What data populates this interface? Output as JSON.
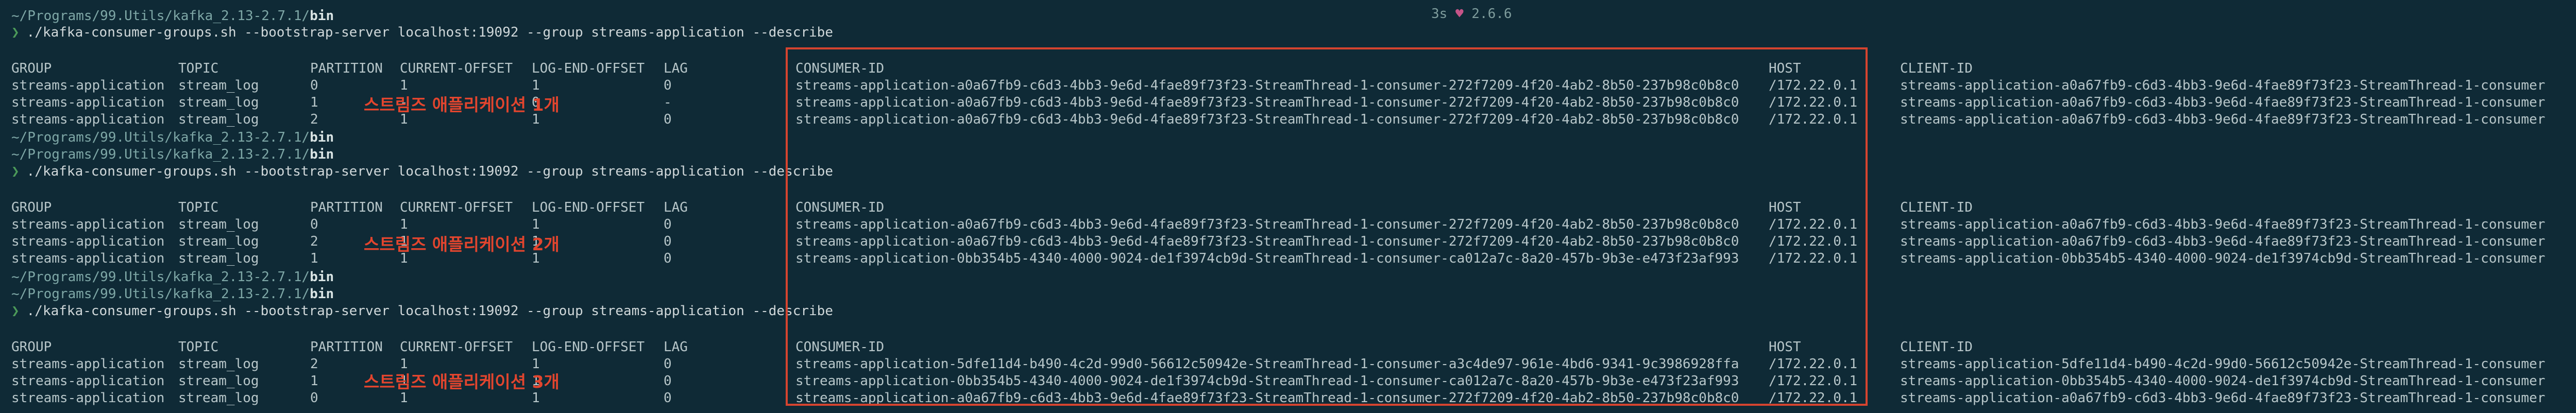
{
  "status": {
    "duration": "3s",
    "heart": "♥",
    "version": "2.6.6"
  },
  "path_prefix": "~/Programs/99.Utils/kafka_2.13-2.7.1/",
  "path_bin": "bin",
  "prompt_symbol": "❯",
  "command": "./kafka-consumer-groups.sh --bootstrap-server localhost:19092 --group streams-application --describe",
  "headers": {
    "group": "GROUP",
    "topic": "TOPIC",
    "partition": "PARTITION",
    "current_offset": "CURRENT-OFFSET",
    "log_end_offset": "LOG-END-OFFSET",
    "lag": "LAG",
    "consumer_id": "CONSUMER-ID",
    "host": "HOST",
    "client_id": "CLIENT-ID"
  },
  "blocks": [
    {
      "label": "스트림즈 애플리케이션 1개",
      "rows": [
        {
          "group": "streams-application",
          "topic": "stream_log",
          "partition": "0",
          "current_offset": "1",
          "log_end_offset": "1",
          "lag": "0",
          "consumer_id": "streams-application-a0a67fb9-c6d3-4bb3-9e6d-4fae89f73f23-StreamThread-1-consumer-272f7209-4f20-4ab2-8b50-237b98c0b8c0",
          "host": "/172.22.0.1",
          "client_id": "streams-application-a0a67fb9-c6d3-4bb3-9e6d-4fae89f73f23-StreamThread-1-consumer"
        },
        {
          "group": "streams-application",
          "topic": "stream_log",
          "partition": "1",
          "current_offset": "-",
          "log_end_offset": "0",
          "lag": "-",
          "consumer_id": "streams-application-a0a67fb9-c6d3-4bb3-9e6d-4fae89f73f23-StreamThread-1-consumer-272f7209-4f20-4ab2-8b50-237b98c0b8c0",
          "host": "/172.22.0.1",
          "client_id": "streams-application-a0a67fb9-c6d3-4bb3-9e6d-4fae89f73f23-StreamThread-1-consumer"
        },
        {
          "group": "streams-application",
          "topic": "stream_log",
          "partition": "2",
          "current_offset": "1",
          "log_end_offset": "1",
          "lag": "0",
          "consumer_id": "streams-application-a0a67fb9-c6d3-4bb3-9e6d-4fae89f73f23-StreamThread-1-consumer-272f7209-4f20-4ab2-8b50-237b98c0b8c0",
          "host": "/172.22.0.1",
          "client_id": "streams-application-a0a67fb9-c6d3-4bb3-9e6d-4fae89f73f23-StreamThread-1-consumer"
        }
      ]
    },
    {
      "label": "스트림즈 애플리케이션 2개",
      "rows": [
        {
          "group": "streams-application",
          "topic": "stream_log",
          "partition": "0",
          "current_offset": "1",
          "log_end_offset": "1",
          "lag": "0",
          "consumer_id": "streams-application-a0a67fb9-c6d3-4bb3-9e6d-4fae89f73f23-StreamThread-1-consumer-272f7209-4f20-4ab2-8b50-237b98c0b8c0",
          "host": "/172.22.0.1",
          "client_id": "streams-application-a0a67fb9-c6d3-4bb3-9e6d-4fae89f73f23-StreamThread-1-consumer"
        },
        {
          "group": "streams-application",
          "topic": "stream_log",
          "partition": "2",
          "current_offset": "1",
          "log_end_offset": "1",
          "lag": "0",
          "consumer_id": "streams-application-a0a67fb9-c6d3-4bb3-9e6d-4fae89f73f23-StreamThread-1-consumer-272f7209-4f20-4ab2-8b50-237b98c0b8c0",
          "host": "/172.22.0.1",
          "client_id": "streams-application-a0a67fb9-c6d3-4bb3-9e6d-4fae89f73f23-StreamThread-1-consumer"
        },
        {
          "group": "streams-application",
          "topic": "stream_log",
          "partition": "1",
          "current_offset": "1",
          "log_end_offset": "1",
          "lag": "0",
          "consumer_id": "streams-application-0bb354b5-4340-4000-9024-de1f3974cb9d-StreamThread-1-consumer-ca012a7c-8a20-457b-9b3e-e473f23af993",
          "host": "/172.22.0.1",
          "client_id": "streams-application-0bb354b5-4340-4000-9024-de1f3974cb9d-StreamThread-1-consumer"
        }
      ]
    },
    {
      "label": "스트림즈 애플리케이션 3개",
      "rows": [
        {
          "group": "streams-application",
          "topic": "stream_log",
          "partition": "2",
          "current_offset": "1",
          "log_end_offset": "1",
          "lag": "0",
          "consumer_id": "streams-application-5dfe11d4-b490-4c2d-99d0-56612c50942e-StreamThread-1-consumer-a3c4de97-961e-4bd6-9341-9c3986928ffa",
          "host": "/172.22.0.1",
          "client_id": "streams-application-5dfe11d4-b490-4c2d-99d0-56612c50942e-StreamThread-1-consumer"
        },
        {
          "group": "streams-application",
          "topic": "stream_log",
          "partition": "1",
          "current_offset": "1",
          "log_end_offset": "1",
          "lag": "0",
          "consumer_id": "streams-application-0bb354b5-4340-4000-9024-de1f3974cb9d-StreamThread-1-consumer-ca012a7c-8a20-457b-9b3e-e473f23af993",
          "host": "/172.22.0.1",
          "client_id": "streams-application-0bb354b5-4340-4000-9024-de1f3974cb9d-StreamThread-1-consumer"
        },
        {
          "group": "streams-application",
          "topic": "stream_log",
          "partition": "0",
          "current_offset": "1",
          "log_end_offset": "1",
          "lag": "0",
          "consumer_id": "streams-application-a0a67fb9-c6d3-4bb3-9e6d-4fae89f73f23-StreamThread-1-consumer-272f7209-4f20-4ab2-8b50-237b98c0b8c0",
          "host": "/172.22.0.1",
          "client_id": "streams-application-a0a67fb9-c6d3-4bb3-9e6d-4fae89f73f23-StreamThread-1-consumer"
        }
      ]
    }
  ]
}
